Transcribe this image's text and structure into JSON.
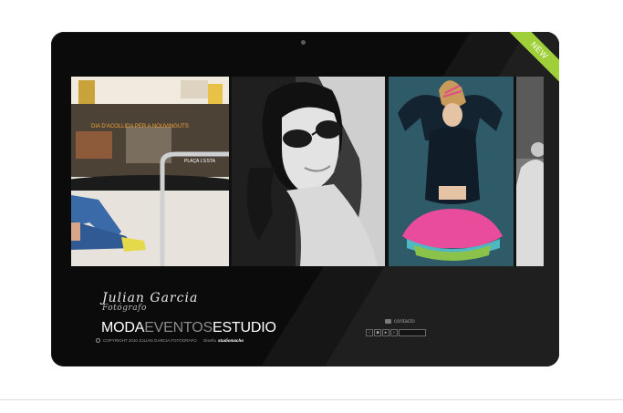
{
  "badge": {
    "label": "NEW"
  },
  "photos": [
    {
      "name": "storefront-photo",
      "sign_text": "DIA D'ACOLLIDA PER A NOUVINGUTS",
      "placa": "PLAÇA L'ESTA"
    },
    {
      "name": "sunglasses-portrait-photo"
    },
    {
      "name": "colorful-dancer-photo"
    },
    {
      "name": "partial-photo"
    }
  ],
  "brand": {
    "name": "Julian Garcia",
    "subtitle": "Fotógrafo"
  },
  "nav": {
    "item1": "MODA",
    "item2": "EVENTOS",
    "item3": "ESTUDIO"
  },
  "footer": {
    "copyright": "COPYRIGHT 2010 JULIAN GARCIA FOTÓGRAFO",
    "design_label": "Diseño",
    "studio": "studiomacho"
  },
  "contact": {
    "label": "contacto"
  },
  "colors": {
    "badge": "#9fd03a",
    "nav_active": "#ffffff",
    "nav_alt": "#8a8a8a",
    "panel": "#0b0b0b"
  }
}
